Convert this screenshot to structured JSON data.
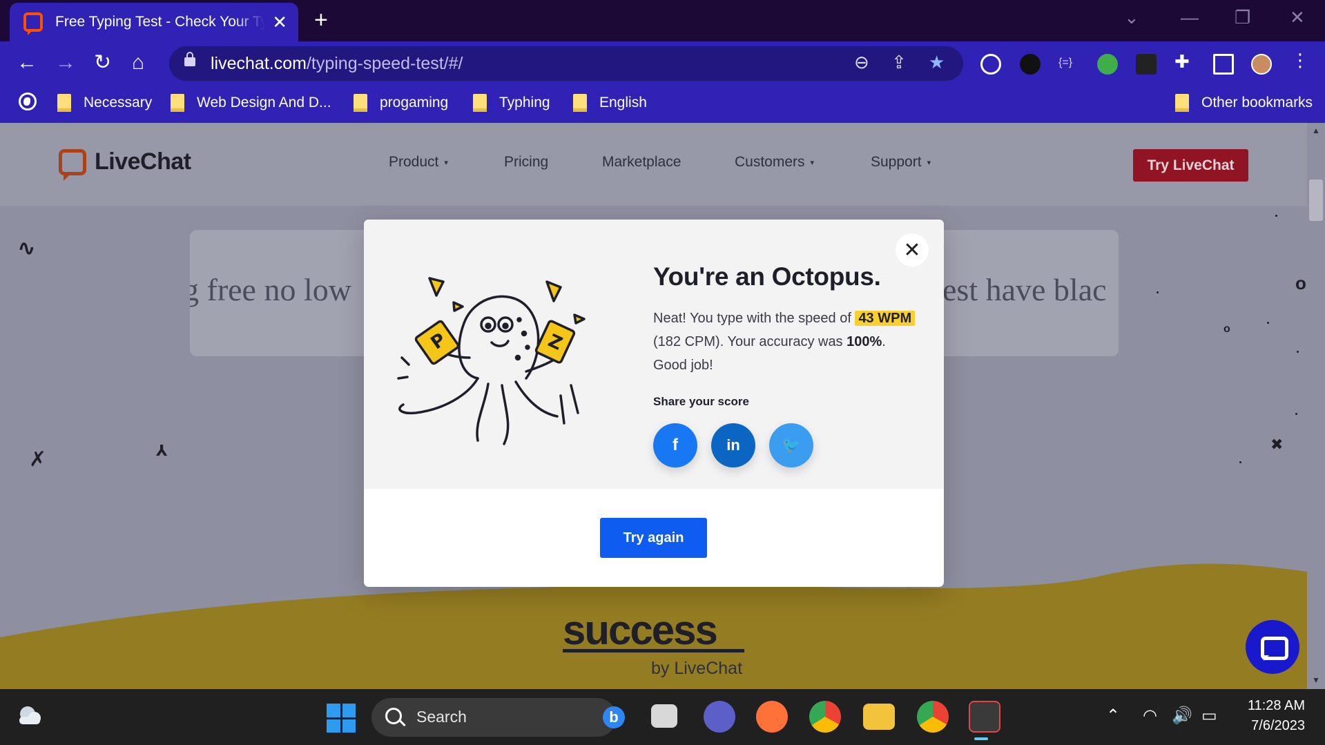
{
  "browser": {
    "tab_title": "Free Typing Test - Check Your Typing Speed",
    "url_domain": "livechat.com",
    "url_path": "/typing-speed-test/#/",
    "bookmarks": [
      "Necessary",
      "Web Design And D...",
      "progaming",
      "Typhing",
      "English"
    ],
    "other_bookmarks": "Other bookmarks",
    "accent_color": "#2f22b5"
  },
  "site": {
    "logo": "LiveChat",
    "nav": [
      {
        "label": "Product",
        "caret": "▾"
      },
      {
        "label": "Pricing",
        "caret": ""
      },
      {
        "label": "Marketplace",
        "caret": ""
      },
      {
        "label": "Customers",
        "caret": "▾"
      },
      {
        "label": "Support",
        "caret": "▾"
      }
    ],
    "cta": "Try LiveChat",
    "typing_left": "g free no low",
    "typing_right": "est have blac",
    "footer_brand": "success",
    "footer_by": "by LiveChat"
  },
  "modal": {
    "title": "You're an Octopus.",
    "text_1": "Neat! You type with the speed of ",
    "wpm": "43 WPM",
    "text_2": " (182 CPM). Your accuracy was ",
    "accuracy": "100%",
    "text_3": ". Good job!",
    "share_label": "Share your score",
    "social": [
      {
        "icon": "facebook-icon",
        "glyph": "f",
        "color": "#1877f2"
      },
      {
        "icon": "linkedin-icon",
        "glyph": "in",
        "color": "#0a66c2"
      },
      {
        "icon": "twitter-icon",
        "glyph": "🐦",
        "color": "#1da1f2"
      }
    ],
    "button": "Try again",
    "close_glyph": "✕"
  },
  "taskbar": {
    "search_placeholder": "Search",
    "time": "11:28 AM",
    "date": "7/6/2023"
  }
}
